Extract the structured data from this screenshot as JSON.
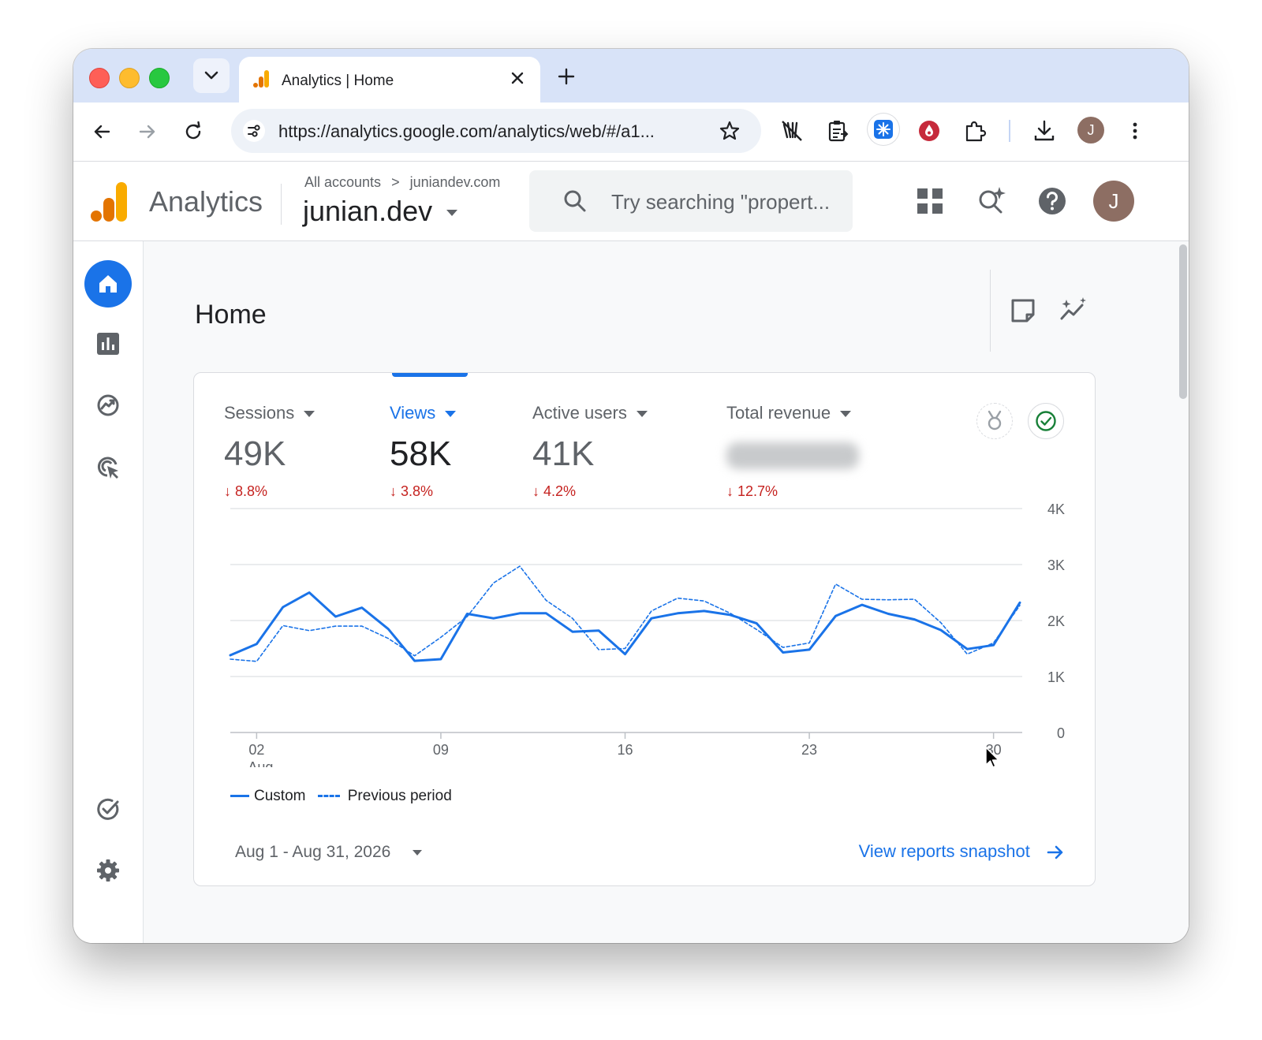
{
  "browser": {
    "tab_title": "Analytics | Home",
    "url": "https://analytics.google.com/analytics/web/#/a1...",
    "profile_initial": "J"
  },
  "header": {
    "app_name": "Analytics",
    "breadcrumb_account": "All accounts",
    "breadcrumb_separator": ">",
    "breadcrumb_property": "juniandev.com",
    "property_name": "junian.dev",
    "search_placeholder": "Try searching \"propert...",
    "avatar_initial": "J"
  },
  "page": {
    "title": "Home"
  },
  "metrics": [
    {
      "label": "Sessions",
      "value": "49K",
      "change": "8.8%",
      "active": false
    },
    {
      "label": "Views",
      "value": "58K",
      "change": "3.8%",
      "active": true
    },
    {
      "label": "Active users",
      "value": "41K",
      "change": "4.2%",
      "active": false
    },
    {
      "label": "Total revenue",
      "value": "",
      "change": "12.7%",
      "active": false
    }
  ],
  "chart_data": {
    "type": "line",
    "x": [
      1,
      2,
      3,
      4,
      5,
      6,
      7,
      8,
      9,
      10,
      11,
      12,
      13,
      14,
      15,
      16,
      17,
      18,
      19,
      20,
      21,
      22,
      23,
      24,
      25,
      26,
      27,
      28,
      29,
      30,
      31
    ],
    "x_ticks": [
      {
        "day": 2,
        "label": "02",
        "sublabel": "Aug"
      },
      {
        "day": 9,
        "label": "09",
        "sublabel": ""
      },
      {
        "day": 16,
        "label": "16",
        "sublabel": ""
      },
      {
        "day": 23,
        "label": "23",
        "sublabel": ""
      },
      {
        "day": 30,
        "label": "30",
        "sublabel": ""
      }
    ],
    "y_ticks": [
      "0",
      "1K",
      "2K",
      "3K",
      "4K"
    ],
    "ylim": [
      0,
      4000
    ],
    "series": [
      {
        "name": "Custom",
        "style": "solid",
        "color": "#1a73e8",
        "values": [
          1380,
          1580,
          2240,
          2500,
          2070,
          2230,
          1850,
          1280,
          1310,
          2120,
          2040,
          2130,
          2130,
          1800,
          1820,
          1400,
          2040,
          2130,
          2170,
          2100,
          1950,
          1430,
          1480,
          2080,
          2280,
          2120,
          2020,
          1830,
          1490,
          1560,
          2320
        ]
      },
      {
        "name": "Previous period",
        "style": "dashed",
        "color": "#1a73e8",
        "values": [
          1310,
          1270,
          1910,
          1820,
          1900,
          1900,
          1680,
          1370,
          1700,
          2070,
          2670,
          2970,
          2360,
          2040,
          1480,
          1500,
          2170,
          2400,
          2350,
          2130,
          1840,
          1520,
          1600,
          2650,
          2380,
          2370,
          2380,
          1960,
          1400,
          1600,
          2270
        ]
      }
    ]
  },
  "footer": {
    "date_range": "Aug 1 - Aug 31, 2026",
    "view_link": "View reports snapshot"
  },
  "colors": {
    "accent": "#1a73e8",
    "negative": "#c5221f",
    "logo_orange": "#f9ab00",
    "logo_dark_orange": "#e37400"
  }
}
